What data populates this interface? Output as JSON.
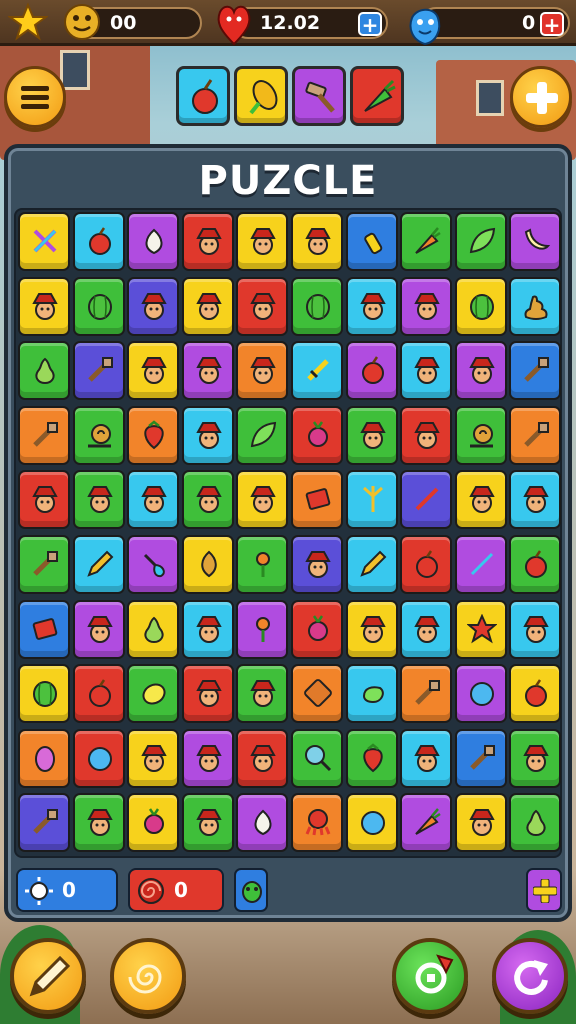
{
  "hud": {
    "coins": "00",
    "lives": "12.02",
    "gems": "0"
  },
  "title": "PUZCLE",
  "footer": {
    "sun_count": "0",
    "spiral_count": "0"
  },
  "colors": {
    "yellow": "#f7d21c",
    "cyan": "#38c8ee",
    "green": "#3fbf3a",
    "red": "#e0382c",
    "purple": "#b04ce0",
    "orange": "#f2842a",
    "blue": "#2f7ee0",
    "indigo": "#5b4fd8"
  },
  "tools": [
    "apple-icon",
    "corn-icon",
    "hammer-icon",
    "carrot-icon"
  ],
  "grid": [
    [
      "yellow:cross-tool-icon",
      "cyan:apple-icon",
      "purple:garlic-icon",
      "red:hat-face-icon",
      "yellow:hat-face-icon",
      "yellow:hat-face-icon",
      "blue:bottle-icon",
      "green:carrot-icon",
      "green:leaf-icon",
      "purple:banana-icon"
    ],
    [
      "yellow:hat-face-icon",
      "green:melon-icon",
      "indigo:hat-face-icon",
      "yellow:hat-face-icon",
      "red:hat-face-icon",
      "green:melon-icon",
      "cyan:hat-face-icon",
      "purple:hat-face-icon",
      "yellow:melon-icon",
      "cyan:poop-icon"
    ],
    [
      "green:pear-icon",
      "indigo:tool-icon",
      "yellow:hat-face-icon",
      "purple:hat-face-icon",
      "orange:hat-face-icon",
      "cyan:sword-icon",
      "purple:apple-icon",
      "cyan:hat-face-icon",
      "purple:hat-face-icon",
      "blue:tool-icon"
    ],
    [
      "orange:tool-icon",
      "green:snail-icon",
      "orange:strawberry-icon",
      "cyan:hat-face-icon",
      "green:leaf-icon",
      "red:radish-icon",
      "green:hat-face-icon",
      "red:hat-face-icon",
      "green:snail-icon",
      "orange:tool-icon"
    ],
    [
      "red:hat-face-icon",
      "green:hat-face-icon",
      "cyan:hat-face-icon",
      "green:hat-face-icon",
      "yellow:hat-face-icon",
      "orange:block-icon",
      "cyan:claw-icon",
      "indigo:wand-icon",
      "yellow:hat-face-icon",
      "cyan:hat-face-icon"
    ],
    [
      "green:tool-icon",
      "cyan:pencil-icon",
      "purple:shovel-icon",
      "yellow:onion-icon",
      "green:flower-icon",
      "indigo:hat-face-icon",
      "cyan:pencil-icon",
      "red:apple-icon",
      "purple:cross-tool-icon",
      "green:apple-icon"
    ],
    [
      "blue:block-icon",
      "purple:hat-face-icon",
      "yellow:pear-icon",
      "cyan:hat-face-icon",
      "purple:flower-icon",
      "red:radish-icon",
      "yellow:hat-face-icon",
      "cyan:hat-face-icon",
      "yellow:star-icon",
      "cyan:hat-face-icon"
    ],
    [
      "yellow:melon-icon",
      "red:apple-icon",
      "green:lemon-icon",
      "red:hat-face-icon",
      "green:hat-face-icon",
      "orange:cookie-icon",
      "cyan:pepper-icon",
      "orange:tool-icon",
      "purple:ball-icon",
      "yellow:apple-icon"
    ],
    [
      "orange:egg-icon",
      "red:ball-icon",
      "yellow:hat-face-icon",
      "purple:hat-face-icon",
      "red:hat-face-icon",
      "green:sieve-icon",
      "green:strawberry-icon",
      "cyan:hat-face-icon",
      "blue:tool-icon",
      "green:hat-face-icon"
    ],
    [
      "indigo:tool-icon",
      "green:hat-face-icon",
      "yellow:radish-icon",
      "green:hat-face-icon",
      "purple:garlic-icon",
      "orange:octopus-icon",
      "yellow:ball-icon",
      "purple:carrot-icon",
      "yellow:hat-face-icon",
      "green:pear-icon"
    ]
  ]
}
